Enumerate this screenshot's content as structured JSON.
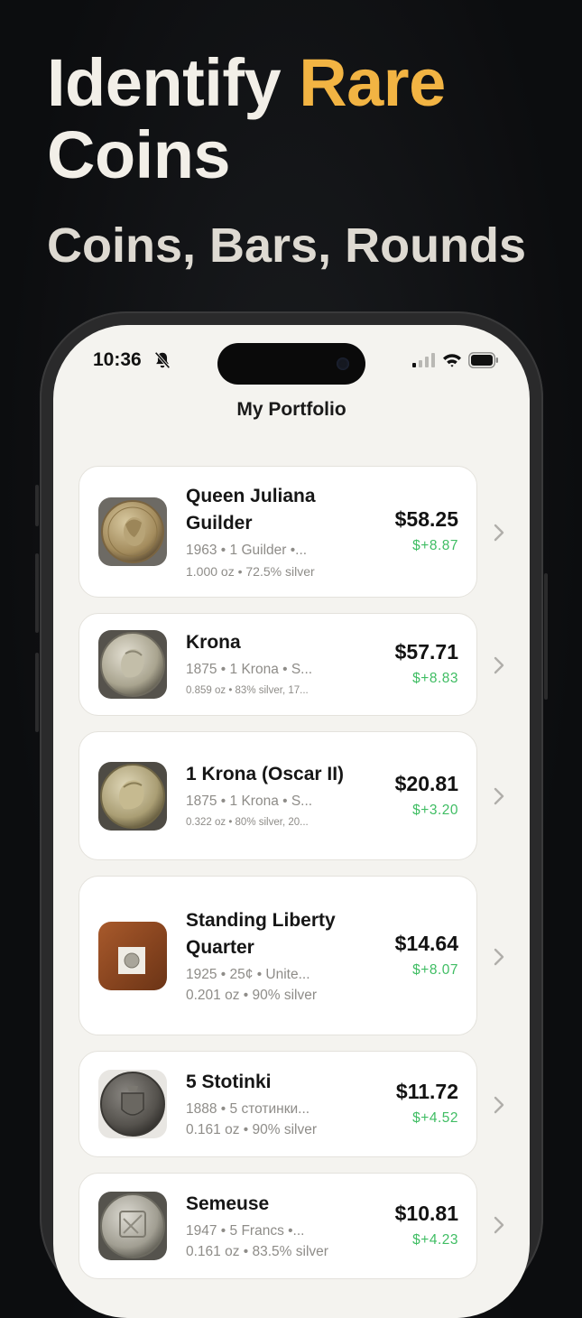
{
  "hero": {
    "title_part1": "Identify ",
    "title_accent": "Rare",
    "title_part2": "Coins",
    "subtitle": "Coins, Bars, Rounds",
    "accent_color": "#f2b443"
  },
  "status_bar": {
    "time": "10:36",
    "icons": [
      "bell-slash-icon",
      "cellular-signal-icon",
      "wifi-icon",
      "battery-icon"
    ]
  },
  "screen": {
    "title": "My Portfolio"
  },
  "coins": [
    {
      "name": "Queen Juliana Guilder",
      "meta": "1963 • 1 Guilder •...",
      "detail": "1.000 oz • 72.5% silver",
      "price": "$58.25",
      "change": "$+8.87",
      "icon": "coin-guilder-thumbnail"
    },
    {
      "name": "Krona",
      "meta": "1875 • 1 Krona • S...",
      "detail": "0.859 oz • 83% silver, 17...",
      "price": "$57.71",
      "change": "$+8.83",
      "icon": "coin-krona-thumbnail"
    },
    {
      "name": "1 Krona (Oscar II)",
      "meta": "1875 • 1 Krona • S...",
      "detail": "0.322 oz • 80% silver, 20...",
      "price": "$20.81",
      "change": "$+3.20",
      "icon": "coin-oscar-thumbnail"
    },
    {
      "name": "Standing Liberty Quarter",
      "meta": "1925 • 25¢ • Unite...",
      "detail": "0.201 oz • 90% silver",
      "price": "$14.64",
      "change": "$+8.07",
      "icon": "coin-quarter-thumbnail"
    },
    {
      "name": "5 Stotinki",
      "meta": "1888 • 5 стотинки...",
      "detail": "0.161 oz • 90% silver",
      "price": "$11.72",
      "change": "$+4.52",
      "icon": "coin-stotinki-thumbnail"
    },
    {
      "name": "Semeuse",
      "meta": "1947 • 5 Francs •...",
      "detail": "0.161 oz • 83.5% silver",
      "price": "$10.81",
      "change": "$+4.23",
      "icon": "coin-semeuse-thumbnail"
    }
  ],
  "colors": {
    "background": "#0c0d0f",
    "screen_bg": "#f4f3ef",
    "gain_green": "#3fbd63"
  }
}
